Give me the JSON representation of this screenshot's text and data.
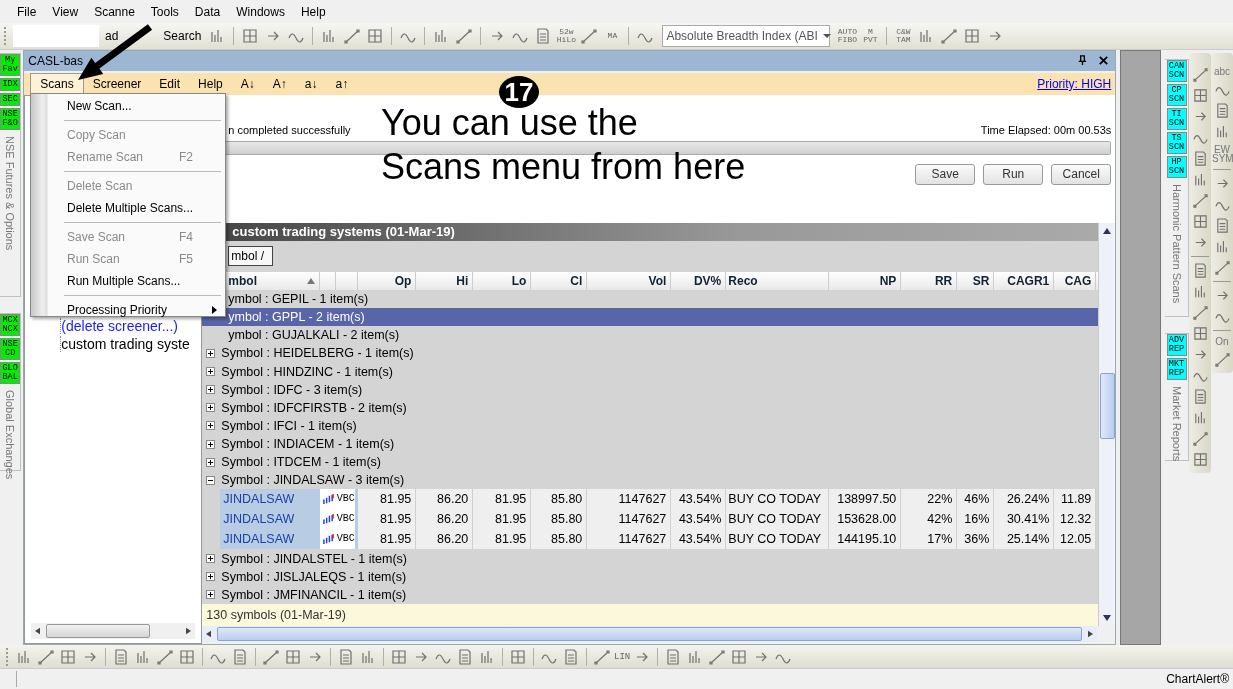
{
  "menubar": [
    {
      "label": "File"
    },
    {
      "label": "View"
    },
    {
      "label": "Scanne"
    },
    {
      "label": "Tools"
    },
    {
      "label": "Data"
    },
    {
      "label": "Windows"
    },
    {
      "label": "Help"
    }
  ],
  "toolbar": {
    "load": "ad",
    "search": "Search",
    "dropdown": "Absolute Breadth Index (ABI",
    "items": [
      {
        "kind": "tool"
      },
      {
        "kind": "sep"
      },
      {
        "kind": "tool"
      },
      {
        "kind": "tool"
      },
      {
        "kind": "tool"
      },
      {
        "kind": "sep"
      },
      {
        "kind": "tool"
      },
      {
        "kind": "tool"
      },
      {
        "kind": "tool"
      },
      {
        "kind": "sep"
      },
      {
        "kind": "tool"
      },
      {
        "kind": "sep"
      },
      {
        "kind": "tool"
      },
      {
        "kind": "tool"
      },
      {
        "kind": "sep"
      },
      {
        "kind": "tool"
      },
      {
        "kind": "tool"
      },
      {
        "kind": "tool"
      },
      {
        "kind": "label",
        "text": "52w HiLo"
      },
      {
        "kind": "tool"
      },
      {
        "kind": "label",
        "text": "MA"
      },
      {
        "kind": "sep"
      },
      {
        "kind": "tool"
      }
    ],
    "items_after": [
      {
        "kind": "label",
        "text": "AUTO FIBO"
      },
      {
        "kind": "label",
        "text": "M PVT"
      },
      {
        "kind": "sep"
      },
      {
        "kind": "label",
        "text": "C&W TAM"
      },
      {
        "kind": "tool"
      },
      {
        "kind": "tool"
      },
      {
        "kind": "tool"
      },
      {
        "kind": "tool"
      }
    ]
  },
  "left_dock": [
    {
      "badges": [
        "My Fav",
        "IDX",
        "SEC",
        "NSE F&O"
      ],
      "label": "NSE Futures & Options"
    },
    {
      "badges": [
        "MCX NCX",
        "NSE CD",
        "GLO BAL"
      ],
      "label": "Global Exchanges"
    }
  ],
  "window": {
    "title": "CASL-bas"
  },
  "screener_menu": [
    {
      "label": "Scans",
      "selected": true
    },
    {
      "label": "Screener",
      "selected": false
    },
    {
      "label": "Edit",
      "selected": false
    },
    {
      "label": "Help",
      "selected": false
    },
    {
      "label": "A↓",
      "selected": false
    },
    {
      "label": "A↑",
      "selected": false
    },
    {
      "label": "a↓",
      "selected": false
    },
    {
      "label": "a↑",
      "selected": false
    }
  ],
  "priority_link": "Priority: HIGH",
  "scans_menu": [
    {
      "kind": "item",
      "label": "New Scan...",
      "disabled": false
    },
    {
      "kind": "separator"
    },
    {
      "kind": "item",
      "label": "Copy Scan",
      "disabled": true
    },
    {
      "kind": "item",
      "label": "Rename Scan",
      "shortcut": "F2",
      "disabled": true
    },
    {
      "kind": "separator"
    },
    {
      "kind": "item",
      "label": "Delete Scan",
      "disabled": true
    },
    {
      "kind": "item",
      "label": "Delete Multiple Scans...",
      "disabled": false
    },
    {
      "kind": "separator"
    },
    {
      "kind": "item",
      "label": "Save Scan",
      "shortcut": "F4",
      "disabled": true
    },
    {
      "kind": "item",
      "label": "Run Scan",
      "shortcut": "F5",
      "disabled": true
    },
    {
      "kind": "item",
      "label": "Run Multiple Scans...",
      "disabled": false
    },
    {
      "kind": "separator"
    },
    {
      "kind": "item",
      "label": "Processing Priority",
      "submenu": true,
      "disabled": false
    }
  ],
  "tree": [
    {
      "kind": "link",
      "label": "(delete screener...)"
    },
    {
      "kind": "item",
      "label": "custom trading syste"
    }
  ],
  "status": {
    "message": "n completed successfully",
    "elapsed": "Time Elapsed: 00m 00.53s",
    "level": 1
  },
  "buttons": [
    "Save",
    "Run",
    "Cancel"
  ],
  "annotation": {
    "badge": "17",
    "lines": [
      "You can use the",
      "Scans menu from here"
    ]
  },
  "grid": {
    "title": "custom trading systems (01-Mar-19)",
    "group_by": "mbol /",
    "columns": [
      "mbol",
      "Op",
      "Hi",
      "Lo",
      "Cl",
      "Vol",
      "DV%",
      "Reco",
      "NP",
      "RR",
      "SR",
      "CAGR1",
      "CAG"
    ],
    "rows": [
      {
        "kind": "group",
        "text": "ymbol : GEPIL - 1 item(s)",
        "selected": false
      },
      {
        "kind": "group",
        "text": "ymbol : GPPL - 2 item(s)",
        "selected": true
      },
      {
        "kind": "group",
        "text": "ymbol : GUJALKALI - 2 item(s)",
        "selected": false
      },
      {
        "kind": "group",
        "text": "Symbol : HEIDELBERG - 1 item(s)",
        "expanded": false,
        "selected": false
      },
      {
        "kind": "group",
        "text": "Symbol : HINDZINC - 1 item(s)",
        "expanded": false,
        "selected": false
      },
      {
        "kind": "group",
        "text": "Symbol : IDFC - 3 item(s)",
        "expanded": false,
        "selected": false
      },
      {
        "kind": "group",
        "text": "Symbol : IDFCFIRSTB - 2 item(s)",
        "expanded": false,
        "selected": false
      },
      {
        "kind": "group",
        "text": "Symbol : IFCI - 1 item(s)",
        "expanded": false,
        "selected": false
      },
      {
        "kind": "group",
        "text": "Symbol : INDIACEM - 1 item(s)",
        "expanded": false,
        "selected": false
      },
      {
        "kind": "group",
        "text": "Symbol : ITDCEM - 1 item(s)",
        "expanded": false,
        "selected": false
      },
      {
        "kind": "group",
        "text": "Symbol : JINDALSAW - 3 item(s)",
        "expanded": true,
        "selected": false
      },
      {
        "kind": "data",
        "symbol": "JINDALSAW",
        "tag": "VBC",
        "values": [
          "81.95",
          "86.20",
          "81.95",
          "85.80",
          "1147627",
          "43.54%",
          "BUY CO TODAY",
          "138997.50",
          "22%",
          "46%",
          "26.24%",
          "11.89"
        ]
      },
      {
        "kind": "data",
        "symbol": "JINDALSAW",
        "tag": "VBC",
        "values": [
          "81.95",
          "86.20",
          "81.95",
          "85.80",
          "1147627",
          "43.54%",
          "BUY CO TODAY",
          "153628.00",
          "42%",
          "16%",
          "30.41%",
          "12.32"
        ]
      },
      {
        "kind": "data",
        "symbol": "JINDALSAW",
        "tag": "VBC",
        "values": [
          "81.95",
          "86.20",
          "81.95",
          "85.80",
          "1147627",
          "43.54%",
          "BUY CO TODAY",
          "144195.10",
          "17%",
          "36%",
          "25.14%",
          "12.05"
        ]
      },
      {
        "kind": "group",
        "text": "Symbol : JINDALSTEL - 1 item(s)",
        "expanded": false,
        "selected": false
      },
      {
        "kind": "group",
        "text": "Symbol : JISLJALEQS - 1 item(s)",
        "expanded": false,
        "selected": false
      },
      {
        "kind": "group",
        "text": "Symbol : JMFINANCIL - 1 item(s)",
        "expanded": false,
        "selected": false
      }
    ],
    "footer": "130 symbols (01-Mar-19)"
  },
  "right_dock": [
    {
      "badges": [
        "CAN SCN",
        "CP SCN",
        "TI SCN",
        "TS SCN",
        "HP SCN"
      ],
      "label": "Harmonic Pattern Scans"
    },
    {
      "badges": [
        "ADV REP",
        "MKT REP"
      ],
      "label": "Market Reports"
    }
  ],
  "palette_1": [
    {
      "kind": "tool"
    },
    {
      "kind": "tool"
    },
    {
      "kind": "tool"
    },
    {
      "kind": "tool"
    },
    {
      "kind": "tool"
    },
    {
      "kind": "tool"
    },
    {
      "kind": "tool"
    },
    {
      "kind": "tool"
    },
    {
      "kind": "tool"
    },
    {
      "kind": "sep"
    },
    {
      "kind": "tool"
    },
    {
      "kind": "tool"
    },
    {
      "kind": "tool"
    },
    {
      "kind": "tool"
    },
    {
      "kind": "tool"
    },
    {
      "kind": "tool"
    },
    {
      "kind": "tool"
    },
    {
      "kind": "tool"
    },
    {
      "kind": "tool"
    },
    {
      "kind": "tool"
    }
  ],
  "palette_2": [
    {
      "kind": "label",
      "text": "abc"
    },
    {
      "kind": "tool"
    },
    {
      "kind": "tool"
    },
    {
      "kind": "tool"
    },
    {
      "kind": "label",
      "text": "EW SYM"
    },
    {
      "kind": "sep"
    },
    {
      "kind": "tool"
    },
    {
      "kind": "tool"
    },
    {
      "kind": "tool"
    },
    {
      "kind": "tool"
    },
    {
      "kind": "tool"
    },
    {
      "kind": "sep"
    },
    {
      "kind": "tool"
    },
    {
      "kind": "tool"
    },
    {
      "kind": "sep"
    },
    {
      "kind": "label",
      "text": "On"
    },
    {
      "kind": "tool"
    }
  ],
  "bottom_toolbar": [
    {
      "kind": "tool"
    },
    {
      "kind": "tool"
    },
    {
      "kind": "tool"
    },
    {
      "kind": "tool"
    },
    {
      "kind": "sep"
    },
    {
      "kind": "tool"
    },
    {
      "kind": "tool"
    },
    {
      "kind": "tool"
    },
    {
      "kind": "tool"
    },
    {
      "kind": "sep"
    },
    {
      "kind": "tool"
    },
    {
      "kind": "tool"
    },
    {
      "kind": "sep"
    },
    {
      "kind": "tool"
    },
    {
      "kind": "tool"
    },
    {
      "kind": "tool"
    },
    {
      "kind": "sep"
    },
    {
      "kind": "tool"
    },
    {
      "kind": "tool"
    },
    {
      "kind": "sep"
    },
    {
      "kind": "tool"
    },
    {
      "kind": "tool"
    },
    {
      "kind": "tool"
    },
    {
      "kind": "tool"
    },
    {
      "kind": "tool"
    },
    {
      "kind": "sep"
    },
    {
      "kind": "tool"
    },
    {
      "kind": "sep"
    },
    {
      "kind": "tool"
    },
    {
      "kind": "tool"
    },
    {
      "kind": "sep"
    },
    {
      "kind": "tool"
    },
    {
      "kind": "label",
      "text": "LIN"
    },
    {
      "kind": "tool"
    },
    {
      "kind": "sep"
    },
    {
      "kind": "tool"
    },
    {
      "kind": "tool"
    },
    {
      "kind": "tool"
    },
    {
      "kind": "tool"
    },
    {
      "kind": "tool"
    },
    {
      "kind": "tool"
    }
  ],
  "status_bar": "ChartAlert®"
}
